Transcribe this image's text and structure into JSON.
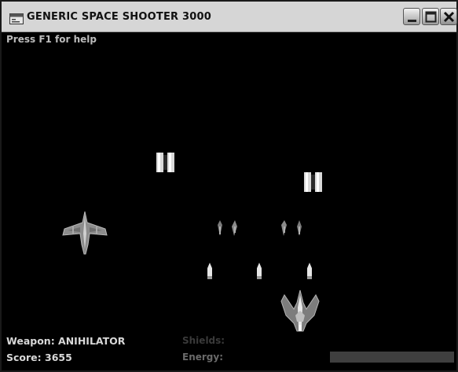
{
  "window": {
    "title": "GENERIC SPACE SHOOTER 3000"
  },
  "titlebar_icons": [
    "app-window-icon",
    "minimize-icon",
    "maximize-icon",
    "close-icon"
  ],
  "hud": {
    "help_text": "Press F1 for help",
    "weapon_label": "Weapon: ANIHILATOR",
    "score_label": "Score: 3655",
    "shields_label": "Shields:",
    "energy_label": "Energy:"
  },
  "colors": {
    "background": "#000000",
    "hud_text": "#d8d8d8",
    "titlebar": "#d6d6d6",
    "energy_bar": "#3f3f3f"
  }
}
